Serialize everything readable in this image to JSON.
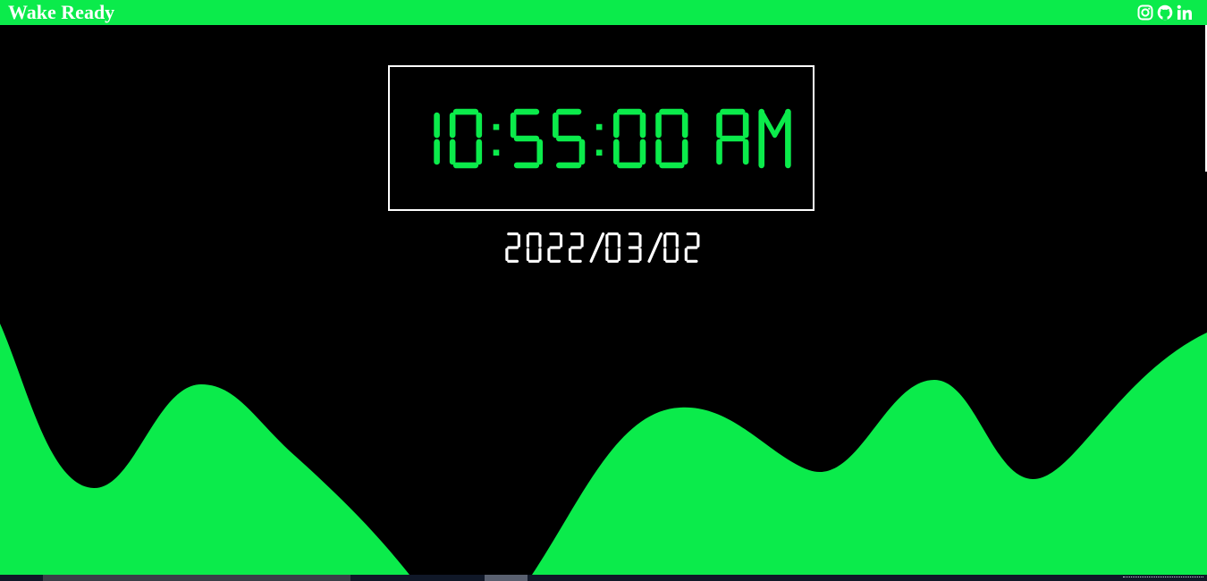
{
  "header": {
    "title": "Wake Ready",
    "social": [
      {
        "icon": "instagram-icon"
      },
      {
        "icon": "github-icon"
      },
      {
        "icon": "linkedin-icon"
      }
    ]
  },
  "clock": {
    "time": "10:55:00 AM",
    "date": "2022/03/02"
  },
  "colors": {
    "accent": "#0beb4b",
    "background": "#000000",
    "text": "#ffffff"
  }
}
